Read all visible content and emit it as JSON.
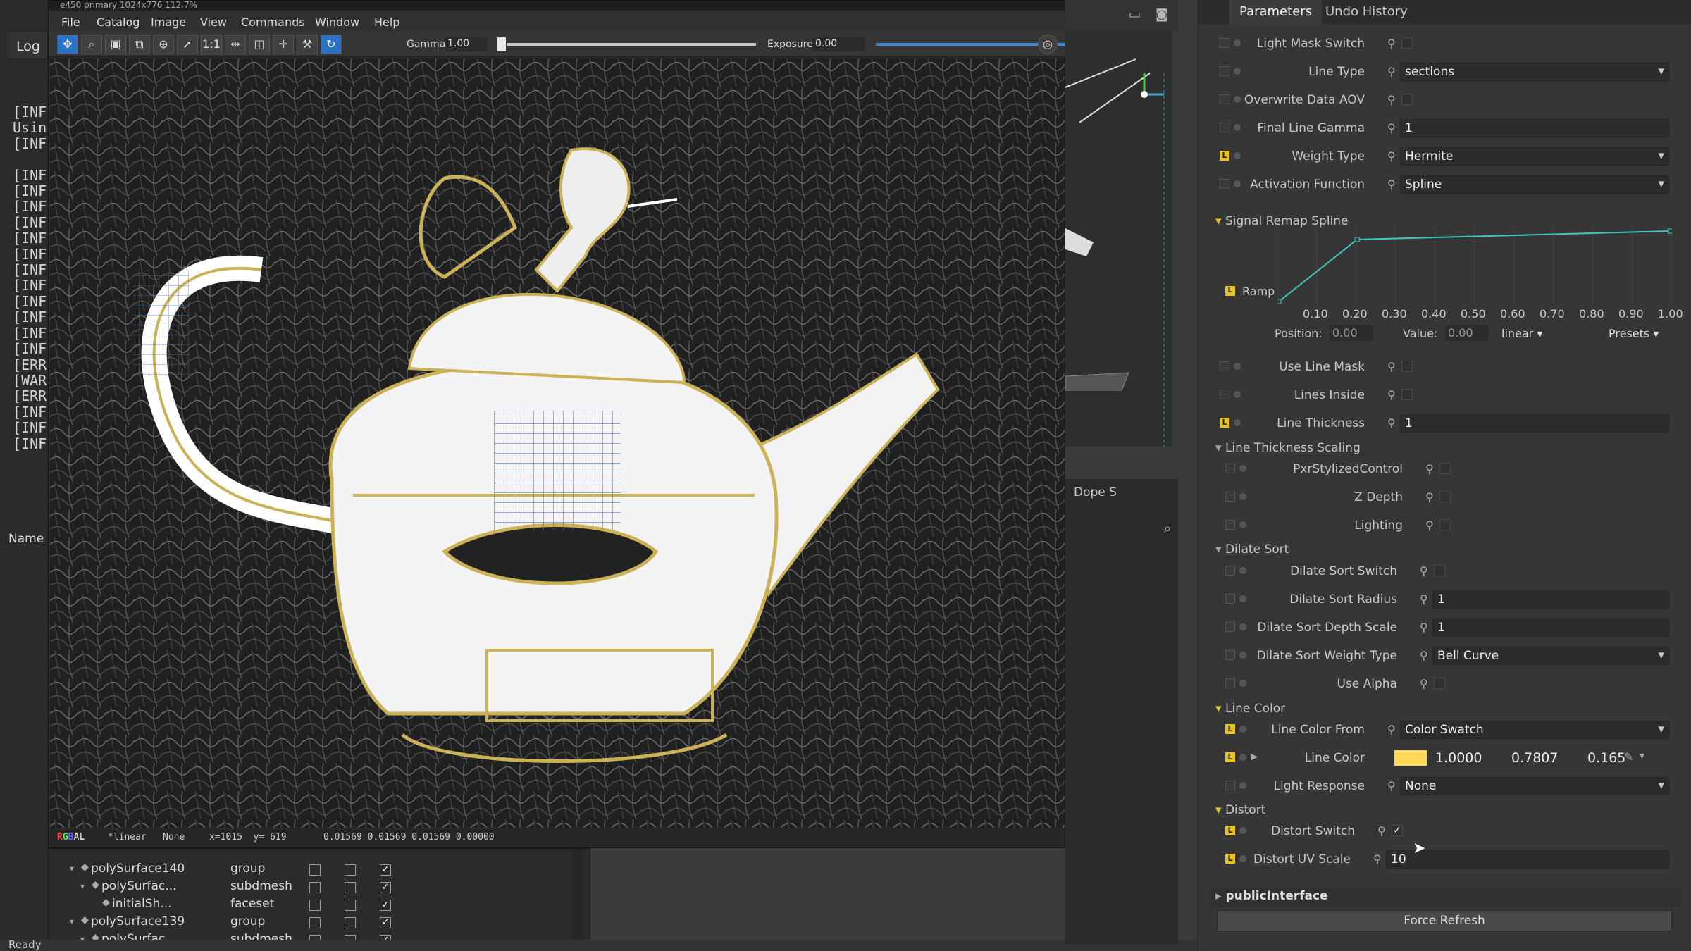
{
  "viewer": {
    "title": "e450 primary 1024x776 112.7%",
    "menu": [
      "File",
      "Catalog",
      "Image",
      "View",
      "Commands",
      "Window",
      "Help"
    ],
    "gamma_label": "Gamma",
    "gamma_value": "1.00",
    "gamma_level": 0.02,
    "exposure_label": "Exposure",
    "exposure_value": "0.00",
    "exposure_level": 0.5,
    "status": {
      "channels": "RGBAL",
      "colorspace": "*linear",
      "lut": "None",
      "coords": "x=1015  y= 619",
      "pixel": "0.01569 0.01569 0.01569 0.00000"
    }
  },
  "log": {
    "tab": "Log",
    "lines": [
      "[INF",
      "Usin",
      "[INF",
      "",
      "[INF",
      "[INF",
      "[INF",
      "[INF",
      "[INF",
      "[INF",
      "[INF",
      "[INF",
      "[INF",
      "[INF",
      "[INF",
      "[INF",
      "[ERR",
      "[WAR",
      "[ERR",
      "[INF",
      "[INF",
      "[INF"
    ]
  },
  "outliner": {
    "name_header": "Name",
    "rows": [
      {
        "name": "polySurface140",
        "type": "group",
        "c1": false,
        "c2": false,
        "c3": true
      },
      {
        "name": "polySurfac...",
        "type": "subdmesh",
        "c1": false,
        "c2": false,
        "c3": true
      },
      {
        "name": "initialSh...",
        "type": "faceset",
        "c1": false,
        "c2": false,
        "c3": true
      },
      {
        "name": "polySurface139",
        "type": "group",
        "c1": false,
        "c2": false,
        "c3": true
      },
      {
        "name": "polySurfac...",
        "type": "subdmesh",
        "c1": false,
        "c2": false,
        "c3": true
      }
    ]
  },
  "app_status": "Ready",
  "dope_label": "Dope S",
  "params": {
    "tabs": [
      "Parameters",
      "Undo History"
    ],
    "rows": [
      {
        "label": "Light Mask Switch",
        "kind": "check",
        "value": ""
      },
      {
        "label": "Line Type",
        "kind": "drop",
        "value": "sections"
      },
      {
        "label": "Overwrite Data AOV",
        "kind": "check",
        "value": ""
      },
      {
        "label": "Final Line Gamma",
        "kind": "field",
        "value": "1"
      },
      {
        "label": "Weight Type",
        "kind": "drop",
        "value": "Hermite",
        "L": true
      },
      {
        "label": "Activation Function",
        "kind": "drop",
        "value": "Spline"
      }
    ],
    "spline": {
      "section": "Signal Remap Spline",
      "ramp_label": "Ramp",
      "ticks": [
        "0.10",
        "0.20",
        "0.30",
        "0.40",
        "0.50",
        "0.60",
        "0.70",
        "0.80",
        "0.90",
        "1.00"
      ],
      "position_label": "Position:",
      "position_value": "0.00",
      "value_label": "Value:",
      "value_value": "0.00",
      "interp": "linear",
      "presets": "Presets",
      "points": [
        [
          0,
          0.0
        ],
        [
          0.2,
          0.88
        ],
        [
          1.0,
          1.0
        ]
      ]
    },
    "rows2": [
      {
        "label": "Use Line Mask",
        "kind": "check",
        "value": ""
      },
      {
        "label": "Lines Inside",
        "kind": "check",
        "value": ""
      },
      {
        "label": "Line Thickness",
        "kind": "field",
        "value": "1",
        "L": true
      }
    ],
    "thickness_section": "Line Thickness Scaling",
    "rows3": [
      {
        "label": "PxrStylizedControl",
        "kind": "check",
        "value": ""
      },
      {
        "label": "Z Depth",
        "kind": "check",
        "value": ""
      },
      {
        "label": "Lighting",
        "kind": "check",
        "value": ""
      }
    ],
    "dilate_section": "Dilate Sort",
    "rows4": [
      {
        "label": "Dilate Sort Switch",
        "kind": "check",
        "value": ""
      },
      {
        "label": "Dilate Sort Radius",
        "kind": "field",
        "value": "1"
      },
      {
        "label": "Dilate Sort Depth Scale",
        "kind": "field",
        "value": "1"
      },
      {
        "label": "Dilate Sort Weight Type",
        "kind": "drop",
        "value": "Bell Curve"
      },
      {
        "label": "Use Alpha",
        "kind": "check",
        "value": ""
      }
    ],
    "color_section": "Line Color",
    "line_color_from_label": "Line Color From",
    "line_color_from": "Color Swatch",
    "line_color_label": "Line Color",
    "line_color_swatch": "#ffd75a",
    "line_color_values": [
      "1.0000",
      "0.7807",
      "0.165"
    ],
    "light_response_label": "Light Response",
    "light_response": "None",
    "distort_section": "Distort",
    "distort_switch_label": "Distort Switch",
    "distort_switch": "✓",
    "distort_uv_label": "Distort UV Scale",
    "distort_uv": "10",
    "public_interface": "publicInterface",
    "force_refresh": "Force Refresh"
  }
}
